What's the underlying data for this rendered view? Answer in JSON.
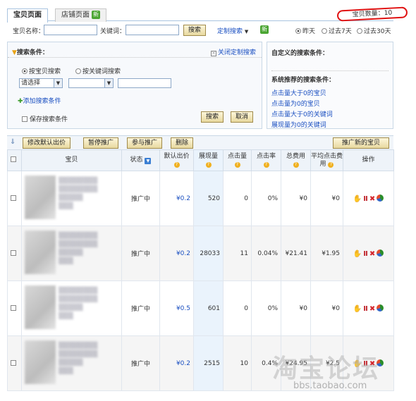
{
  "tabs": [
    {
      "label": "宝贝页面"
    },
    {
      "label": "店铺页面",
      "badge": "新"
    }
  ],
  "item_count": "宝贝数量：10",
  "filter": {
    "name_label": "宝贝名称：",
    "keyword_label": "关键词：",
    "search_btn": "搜索",
    "custom_search": "定制搜索",
    "custom_badge": "新",
    "range_options": [
      "昨天",
      "过去7天",
      "过去30天"
    ],
    "range_selected": "昨天"
  },
  "condition": {
    "title": "搜索条件：",
    "close_label": "关闭定制搜索",
    "mode_options": [
      "按宝贝搜索",
      "按关键词搜索"
    ],
    "select_placeholder": "请选择",
    "add_condition": "添加搜索条件",
    "save_condition": "保存搜索条件",
    "search_btn": "搜索",
    "cancel_btn": "取消"
  },
  "custom": {
    "title": "自定义的搜索条件：",
    "recommended_title": "系统推荐的搜索条件：",
    "recommended": [
      "点击量大于0的宝贝",
      "点击量为0的宝贝",
      "点击量大于0的关键词",
      "展现量为0的关键词"
    ]
  },
  "toolbar": {
    "modify_default": "修改默认出价",
    "pause": "暂停推广",
    "join": "参与推广",
    "delete": "删除",
    "promote_new": "推广新的宝贝"
  },
  "table": {
    "headers": [
      "宝贝",
      "状态",
      "默认出价",
      "展现量",
      "点击量",
      "点击率",
      "总费用",
      "平均点击费用",
      "操作"
    ],
    "rows": [
      {
        "status": "推广中",
        "bid": "¥0.2",
        "impressions": "520",
        "clicks": "0",
        "ctr": "0%",
        "cost": "¥0",
        "avg_cpc": "¥0"
      },
      {
        "status": "推广中",
        "bid": "¥0.2",
        "impressions": "28033",
        "clicks": "11",
        "ctr": "0.04%",
        "cost": "¥21.41",
        "avg_cpc": "¥1.95"
      },
      {
        "status": "推广中",
        "bid": "¥0.5",
        "impressions": "601",
        "clicks": "0",
        "ctr": "0%",
        "cost": "¥0",
        "avg_cpc": "¥0"
      },
      {
        "status": "推广中",
        "bid": "¥0.2",
        "impressions": "2515",
        "clicks": "10",
        "ctr": "0.4%",
        "cost": "¥24.95",
        "avg_cpc": "¥2.5"
      }
    ]
  },
  "watermark": {
    "logo": "淘宝论坛",
    "url": "bbs.taobao.com"
  },
  "colors": {
    "link": "#1a4fc1",
    "highlight": "#e01010",
    "new_badge": "#4aa532"
  }
}
